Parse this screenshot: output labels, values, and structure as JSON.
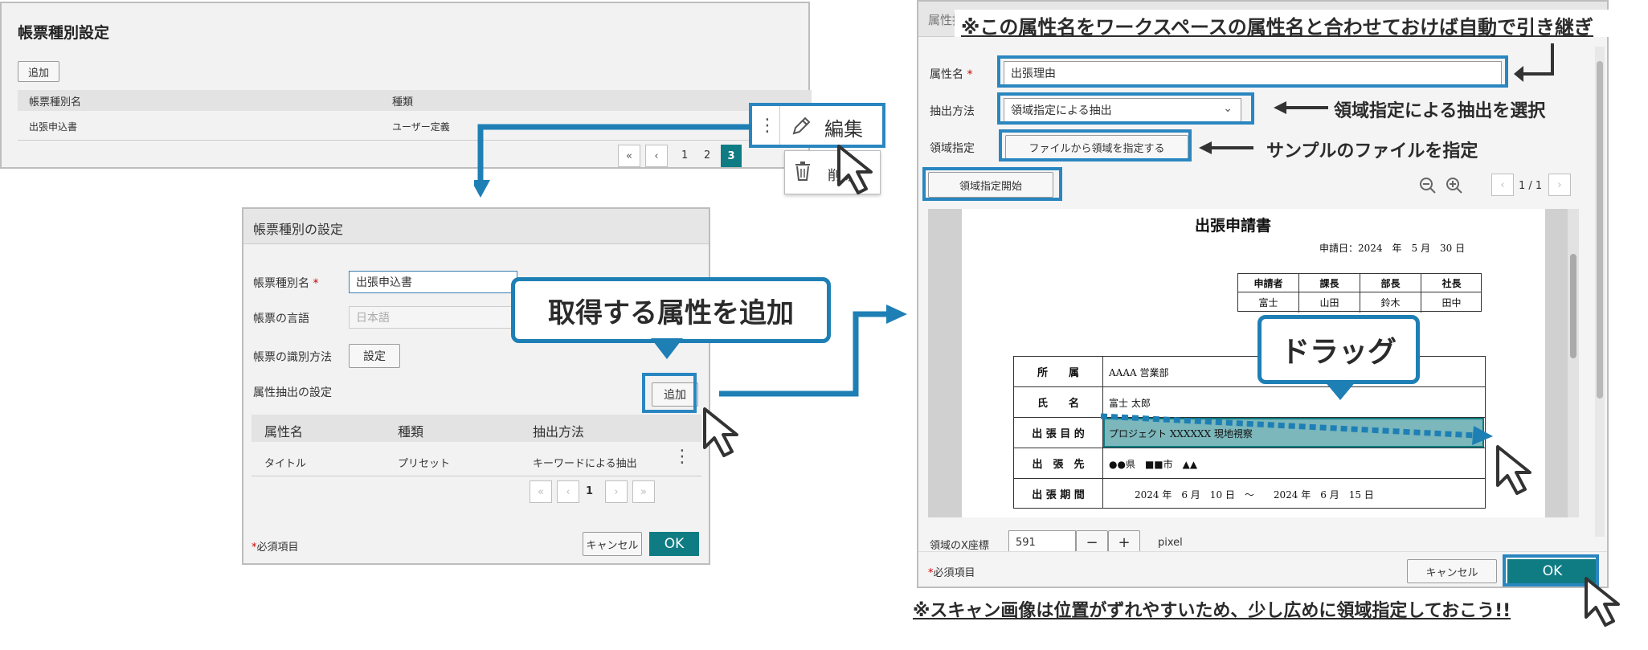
{
  "panel1": {
    "title": "帳票種別設定",
    "add_label": "追加",
    "col_name": "帳票種別名",
    "col_type": "種類",
    "row_name": "出張申込書",
    "row_type": "ユーザー定義",
    "pages": [
      "1",
      "2",
      "3"
    ],
    "current_page": "3"
  },
  "context_menu": {
    "edit_label": "編集",
    "delete_label": "削除"
  },
  "panel2": {
    "title": "帳票種別の設定",
    "name_label": "帳票種別名",
    "name_value": "出張申込書",
    "lang_label": "帳票の言語",
    "lang_value": "日本語",
    "ident_label": "帳票の識別方法",
    "ident_button": "設定",
    "attr_label": "属性抽出の設定",
    "add_label": "追加",
    "col_attr": "属性名",
    "col_type": "種類",
    "col_method": "抽出方法",
    "row_attr": "タイトル",
    "row_type": "プリセット",
    "row_method": "キーワードによる抽出",
    "page": "1",
    "required_note": "必須項目",
    "cancel_label": "キャンセル",
    "ok_label": "OK"
  },
  "panel3": {
    "title": "属性抽出の設定",
    "attr_label": "属性名",
    "attr_value": "出張理由",
    "method_label": "抽出方法",
    "method_value": "領域指定による抽出",
    "area_label": "領域指定",
    "file_button": "ファイルから領域を指定する",
    "start_button": "領域指定開始",
    "page_info": "1 / 1",
    "x_label": "領域のX座標",
    "x_value": "591",
    "x_unit": "pixel",
    "required_note": "必須項目",
    "cancel_label": "キャンセル",
    "ok_label": "OK"
  },
  "document": {
    "title": "出張申請書",
    "date": "申請日：2024　年　5 月　30 日",
    "approvals": [
      "申請者",
      "課長",
      "部長",
      "社長"
    ],
    "approvers": [
      "富士",
      "山田",
      "鈴木",
      "田中"
    ],
    "rows": [
      {
        "label": "所　　属",
        "value": "AAAA 営業部"
      },
      {
        "label": "氏　　名",
        "value": "富士 太郎"
      },
      {
        "label": "出 張 目 的",
        "value": "プロジェクト XXXXXX 現地視察"
      },
      {
        "label": "出　張　先",
        "value": "●●県　■■市　▲▲"
      },
      {
        "label": "出 張 期 間",
        "value": "2024 年　6 月　10 日　～　　2024 年　6 月　15 日"
      }
    ]
  },
  "annotations": {
    "callout_add": "取得する属性を追加",
    "callout_drag": "ドラッグ",
    "top_note": "※この属性名をワークスペースの属性名と合わせておけば自動で引き継ぎ",
    "method_note": "領域指定による抽出を選択",
    "file_note": "サンプルのファイルを指定",
    "bottom_note": "※スキャン画像は位置がずれやすいため、少し広めに領域指定しておこう!!"
  },
  "colors": {
    "accent_blue": "#1e7fb5",
    "ok_teal": "#0f7c83",
    "page_active": "#0f7c83"
  }
}
